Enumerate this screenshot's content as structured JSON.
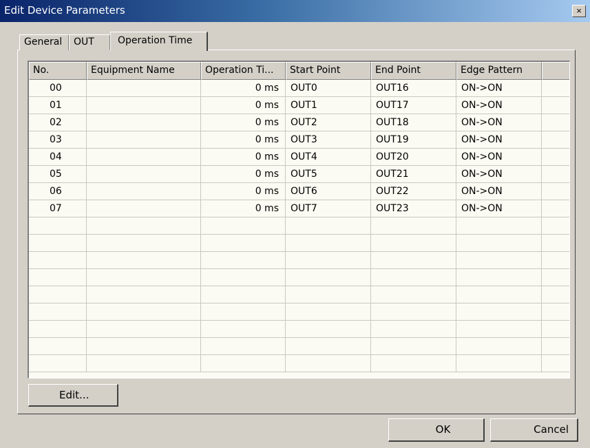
{
  "window": {
    "title": "Edit Device Parameters",
    "close_label": "×"
  },
  "tabs": [
    {
      "label": "General"
    },
    {
      "label": "OUT"
    },
    {
      "label": "Operation Time"
    }
  ],
  "grid": {
    "columns": [
      "No.",
      "Equipment Name",
      "Operation Ti...",
      "Start Point",
      "End Point",
      "Edge Pattern"
    ],
    "rows": [
      {
        "no": "00",
        "name": "",
        "op_time": "0 ms",
        "start": "OUT0",
        "end": "OUT16",
        "edge": "ON->ON"
      },
      {
        "no": "01",
        "name": "",
        "op_time": "0 ms",
        "start": "OUT1",
        "end": "OUT17",
        "edge": "ON->ON"
      },
      {
        "no": "02",
        "name": "",
        "op_time": "0 ms",
        "start": "OUT2",
        "end": "OUT18",
        "edge": "ON->ON"
      },
      {
        "no": "03",
        "name": "",
        "op_time": "0 ms",
        "start": "OUT3",
        "end": "OUT19",
        "edge": "ON->ON"
      },
      {
        "no": "04",
        "name": "",
        "op_time": "0 ms",
        "start": "OUT4",
        "end": "OUT20",
        "edge": "ON->ON"
      },
      {
        "no": "05",
        "name": "",
        "op_time": "0 ms",
        "start": "OUT5",
        "end": "OUT21",
        "edge": "ON->ON"
      },
      {
        "no": "06",
        "name": "",
        "op_time": "0 ms",
        "start": "OUT6",
        "end": "OUT22",
        "edge": "ON->ON"
      },
      {
        "no": "07",
        "name": "",
        "op_time": "0 ms",
        "start": "OUT7",
        "end": "OUT23",
        "edge": "ON->ON"
      }
    ]
  },
  "buttons": {
    "edit_label": "Edit...",
    "ok_label": "OK",
    "cancel_label": "Cancel"
  }
}
